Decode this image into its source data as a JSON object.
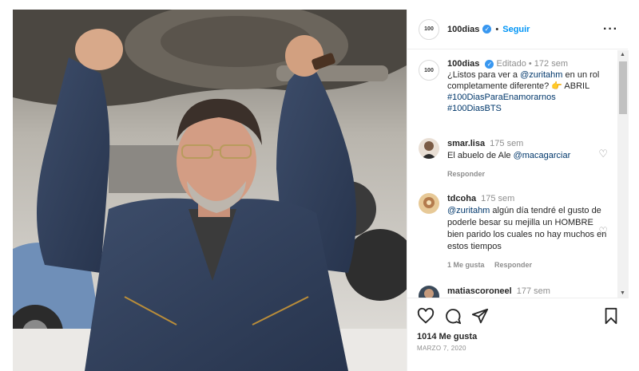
{
  "post": {
    "image_alt": "mechanic working under a car",
    "account": "100dias",
    "verified_icon": "verified-badge-icon",
    "follow_label": "Seguir",
    "more_icon": "more-options-icon",
    "logo_text": "100"
  },
  "caption": {
    "username": "100dias",
    "edited": "Editado",
    "time": "172 sem",
    "text_1": "¿Listos para ver a",
    "mention": "@zuritahm",
    "text_2": "en un rol completamente diferente? 👉 ABRIL",
    "tag_1": "#100DiasParaEnamorarnos",
    "tag_2": "#100DiasBTS"
  },
  "comments": [
    {
      "username": "smar.lisa",
      "time": "175 sem",
      "text": "El abuelo de Ale",
      "mention": "@macagarciar",
      "reply": "Responder"
    },
    {
      "username": "tdcoha",
      "time": "175 sem",
      "mention": "@zuritahm",
      "text": "algún día tendré el gusto de poderle besar su mejilla un HOMBRE bien parido los cuales no hay muchos en estos tiempos",
      "likes": "1 Me gusta",
      "reply": "Responder"
    },
    {
      "username": "matiascoroneel",
      "time": "177 sem"
    }
  ],
  "footer": {
    "likes": "1014 Me gusta",
    "date": "MARZO 7, 2020"
  },
  "colors": {
    "accent": "#0095f6",
    "verified": "#3897f0",
    "muted": "#8e8e8e",
    "link": "#00376b"
  }
}
